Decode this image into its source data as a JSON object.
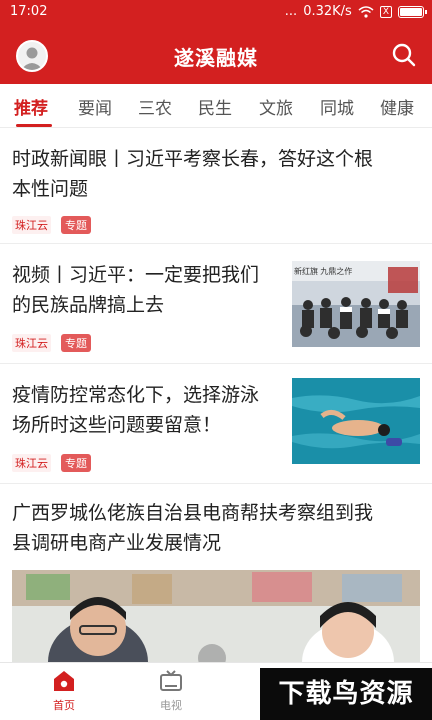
{
  "status_bar": {
    "time": "17:02",
    "dots": "...",
    "network_speed": "0.32K/s",
    "sim_icon_text": "X",
    "battery_level": 0.9
  },
  "header": {
    "title": "遂溪融媒",
    "avatar_icon": "user-avatar-icon",
    "search_icon": "search-icon"
  },
  "tabs": [
    {
      "label": "推荐",
      "active": true
    },
    {
      "label": "要闻"
    },
    {
      "label": "三农"
    },
    {
      "label": "民生"
    },
    {
      "label": "文旅"
    },
    {
      "label": "同城"
    },
    {
      "label": "健康"
    }
  ],
  "articles": [
    {
      "title_line1": "时政新闻眼丨习近平考察长春，答好这个根",
      "title_line2": "本性问题",
      "source": "珠江云",
      "tag": "专题"
    },
    {
      "title_line1": "视频丨习近平：一定要把我们",
      "title_line2": "的民族品牌搞上去",
      "source": "珠江云",
      "tag": "专题",
      "thumb_caption": "新红旗 九鼎之作"
    },
    {
      "title_line1": "疫情防控常态化下，选择游泳",
      "title_line2": "场所时这些问题要留意！",
      "source": "珠江云",
      "tag": "专题"
    },
    {
      "title_line1": "广西罗城仫佬族自治县电商帮扶考察组到我",
      "title_line2": "县调研电商产业发展情况"
    }
  ],
  "bottom_nav": [
    {
      "label": "首页",
      "icon": "home-icon",
      "active": true
    },
    {
      "label": "电视",
      "icon": "tv-icon"
    }
  ],
  "watermark": "下载鸟资源",
  "colors": {
    "brand": "#d32020"
  }
}
